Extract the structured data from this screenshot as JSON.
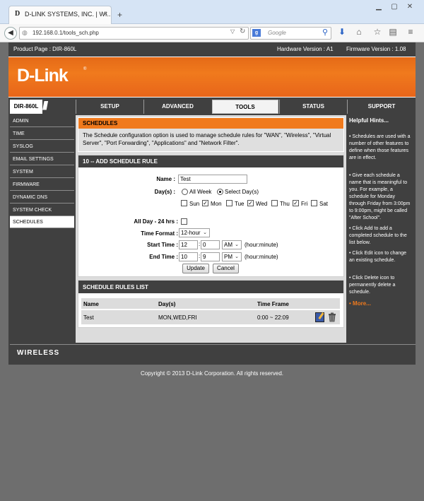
{
  "browser": {
    "tab_title": "D-LINK SYSTEMS, INC. | WI...",
    "tab_close": "×",
    "new_tab": "+",
    "url": "192.168.0.1/tools_sch.php",
    "search_placeholder": "Google",
    "search_engine": "g",
    "window_controls": [
      "minimize-icon",
      "maximize-icon",
      "close-icon"
    ],
    "nav_icons": [
      "back-icon",
      "reload-icon",
      "download-icon",
      "home-icon",
      "bookmark-star-icon",
      "reading-list-icon",
      "menu-icon"
    ]
  },
  "header": {
    "product": "Product Page : DIR-860L",
    "hardware": "Hardware Version : A1",
    "firmware": "Firmware Version : 1.08",
    "logo": "D-Link",
    "logo_reg": "®",
    "model": "DIR-860L",
    "slashes": "///"
  },
  "top_nav": [
    {
      "label": "SETUP"
    },
    {
      "label": "ADVANCED"
    },
    {
      "label": "TOOLS"
    },
    {
      "label": "STATUS"
    },
    {
      "label": "SUPPORT"
    }
  ],
  "side_nav": [
    {
      "label": "ADMIN"
    },
    {
      "label": "TIME"
    },
    {
      "label": "SYSLOG"
    },
    {
      "label": "EMAIL SETTINGS"
    },
    {
      "label": "SYSTEM"
    },
    {
      "label": "FIRMWARE"
    },
    {
      "label": "DYNAMIC DNS"
    },
    {
      "label": "SYSTEM CHECK"
    },
    {
      "label": "SCHEDULES"
    }
  ],
  "schedules": {
    "heading": "SCHEDULES",
    "description": "The Schedule configuration option is used to manage schedule rules for \"WAN\", \"Wireless\", \"Virtual Server\", \"Port Forwarding\", \"Applications\" and \"Network Filter\"."
  },
  "add_rule": {
    "heading": "10 -- ADD SCHEDULE RULE",
    "name_label": "Name :",
    "name_value": "Test",
    "days_label": "Day(s) :",
    "all_week": "All Week",
    "select_days": "Select Day(s)",
    "days": [
      {
        "label": "Sun",
        "checked": false
      },
      {
        "label": "Mon",
        "checked": true
      },
      {
        "label": "Tue",
        "checked": false
      },
      {
        "label": "Wed",
        "checked": true
      },
      {
        "label": "Thu",
        "checked": false
      },
      {
        "label": "Fri",
        "checked": true
      },
      {
        "label": "Sat",
        "checked": false
      }
    ],
    "allday_label": "All Day - 24 hrs :",
    "time_format_label": "Time Format :",
    "time_format_value": "12-hour",
    "start_label": "Start Time :",
    "start_hour": "12",
    "start_min": "0",
    "start_ampm": "AM",
    "end_label": "End Time :",
    "end_hour": "10",
    "end_min": "9",
    "end_ampm": "PM",
    "colon": ":",
    "hint_hm": "(hour:minute)",
    "update_button": "Update",
    "cancel_button": "Cancel"
  },
  "rules_list": {
    "heading": "SCHEDULE RULES LIST",
    "columns": [
      "Name",
      "Day(s)",
      "Time Frame"
    ],
    "rows": [
      {
        "name": "Test",
        "days": "MON,WED,FRI",
        "time": "0:00 ~ 22:09"
      }
    ]
  },
  "hints": {
    "title": "Helpful Hints...",
    "items": [
      "• Schedules are used with a number of other features to define when those features are in effect.",
      "• Give each schedule a name that is meaningful to you. For example, a schedule for Monday through Friday from 3:00pm to 9:00pm, might be called \"After School\".",
      "• Click Add to add a completed schedule to the list below.",
      "• Click Edit icon to change an existing schedule.",
      "• Click Delete icon to permanently delete a schedule."
    ],
    "more": "• More..."
  },
  "footer": {
    "wireless": "WIRELESS",
    "copyright": "Copyright © 2013 D-Link Corporation. All rights reserved."
  }
}
